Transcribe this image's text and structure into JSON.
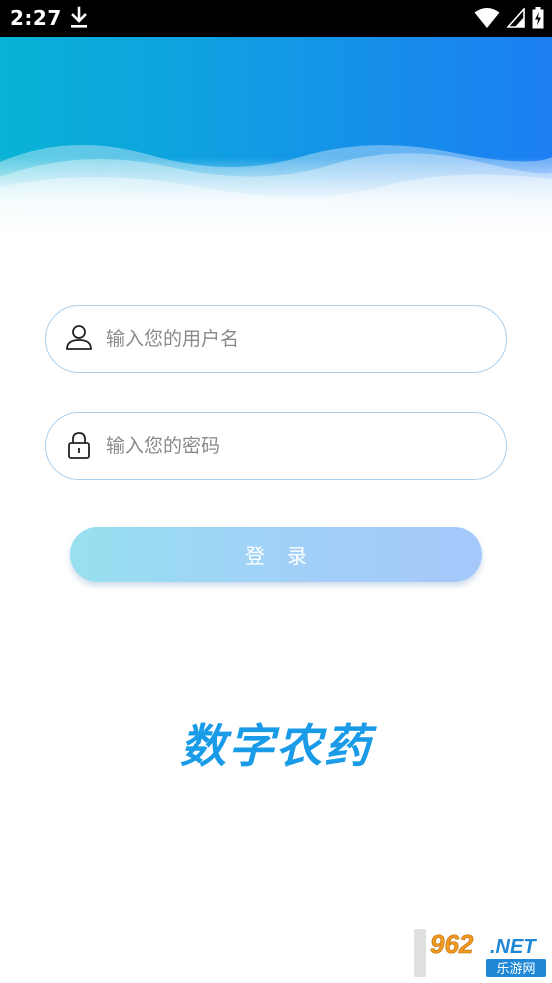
{
  "status_bar": {
    "time": "2:27",
    "icons": [
      "download-icon",
      "wifi-icon",
      "signal-icon",
      "battery-charging-icon"
    ]
  },
  "login_form": {
    "username": {
      "placeholder": "输入您的用户名",
      "value": "",
      "icon": "user-icon"
    },
    "password": {
      "placeholder": "输入您的密码",
      "value": "",
      "icon": "lock-icon"
    },
    "submit_label": "登录"
  },
  "brand": {
    "title": "数字农药"
  },
  "watermark": {
    "text": "962.NET",
    "subtext": "乐游网"
  },
  "colors": {
    "header_gradient_start": "#08b3d6",
    "header_gradient_end": "#1c7ff3",
    "field_border": "#a9cfee",
    "button_gradient_start": "#98e0ef",
    "button_gradient_end": "#a5c8fb",
    "brand": "#1a9be8"
  }
}
